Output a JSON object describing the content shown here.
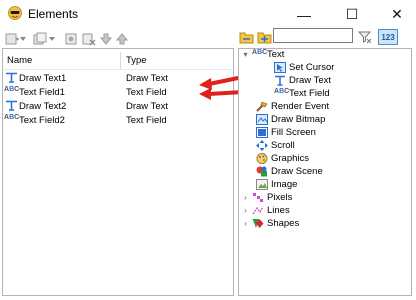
{
  "window": {
    "title": "Elements",
    "minimize_glyph": "—",
    "maximize_glyph": "☐",
    "close_glyph": "✕"
  },
  "toolbar": {
    "icons": [
      "add-element-icon",
      "add-group-icon",
      "properties-icon",
      "delete-icon",
      "move-down-icon",
      "move-up-icon"
    ],
    "search_value": "",
    "sort_label": "123"
  },
  "table": {
    "columns": [
      "Name",
      "Type"
    ],
    "rows": [
      {
        "icon": "draw-text-icon",
        "name": "Draw Text1",
        "type": "Draw Text"
      },
      {
        "icon": "text-field-icon",
        "name": "Text Field1",
        "type": "Text Field"
      },
      {
        "icon": "draw-text-icon",
        "name": "Draw Text2",
        "type": "Draw Text"
      },
      {
        "icon": "text-field-icon",
        "name": "Text Field2",
        "type": "Text Field"
      }
    ]
  },
  "tree": {
    "items": [
      {
        "label": "Text",
        "icon": "text-category-icon",
        "expander": "▾"
      },
      {
        "label": "Set Cursor",
        "icon": "set-cursor-icon"
      },
      {
        "label": "Draw Text",
        "icon": "draw-text-icon"
      },
      {
        "label": "Text Field",
        "icon": "text-field-icon"
      },
      {
        "label": "Render Event",
        "icon": "render-event-icon"
      },
      {
        "label": "Draw Bitmap",
        "icon": "draw-bitmap-icon"
      },
      {
        "label": "Fill Screen",
        "icon": "fill-screen-icon"
      },
      {
        "label": "Scroll",
        "icon": "scroll-icon"
      },
      {
        "label": "Graphics",
        "icon": "graphics-icon"
      },
      {
        "label": "Draw Scene",
        "icon": "draw-scene-icon"
      },
      {
        "label": "Image",
        "icon": "image-icon"
      },
      {
        "label": "Pixels",
        "icon": "pixels-icon",
        "expander": "›"
      },
      {
        "label": "Lines",
        "icon": "lines-icon",
        "expander": "›"
      },
      {
        "label": "Shapes",
        "icon": "shapes-icon",
        "expander": "›"
      }
    ]
  },
  "colors": {
    "accent": "#2a6fd6",
    "annotation_arrow": "#e0201c",
    "selected_toggle_bg": "#cfe3f6"
  }
}
